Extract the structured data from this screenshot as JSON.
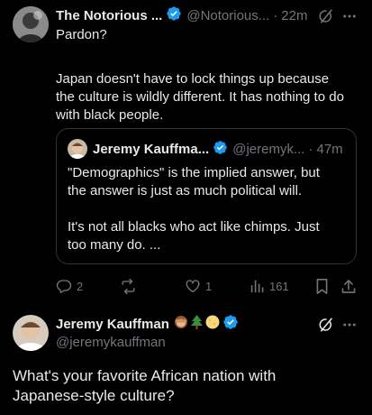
{
  "tweet": {
    "author_name": "The Notorious ...",
    "handle": "@Notorious...",
    "separator": "·",
    "time": "22m",
    "line1": "Pardon?",
    "para2_line1": "Japan doesn't have to lock things up because",
    "para2_line2": "the culture is wildly different. It has nothing to do",
    "para2_line3": "with black people.",
    "quote": {
      "author_name": "Jeremy Kauffma...",
      "handle": "@jeremyk...",
      "separator": "·",
      "time": "47m",
      "line1": "\"Demographics\" is the implied answer, but",
      "line2": "the answer is just as much political will.",
      "line3": "It's not all blacks who act like chimps. Just",
      "line4": "too many do. ..."
    },
    "actions": {
      "reply_count": "2",
      "like_count": "1",
      "views_count": "161"
    }
  },
  "reply_tweet": {
    "author_name": "Jeremy Kauffman",
    "handle": "@jeremykauffman",
    "line1": "What's your favorite African nation with",
    "line2": "Japanese-style culture?"
  },
  "icons": {
    "verified": "verified-badge-icon",
    "grok": "grok-icon",
    "more": "more-icon",
    "reply": "reply-icon",
    "retweet": "retweet-icon",
    "like": "like-icon",
    "views": "views-icon",
    "bookmark": "bookmark-icon",
    "share": "share-icon",
    "emoji_monkey": "see-no-evil-monkey-emoji",
    "emoji_tree": "evergreen-tree-emoji",
    "emoji_moon": "full-moon-emoji"
  },
  "colors": {
    "background": "#000000",
    "text": "#e7e9ea",
    "muted": "#71767b",
    "verified": "#1d9bf0",
    "border": "#2f3336"
  }
}
